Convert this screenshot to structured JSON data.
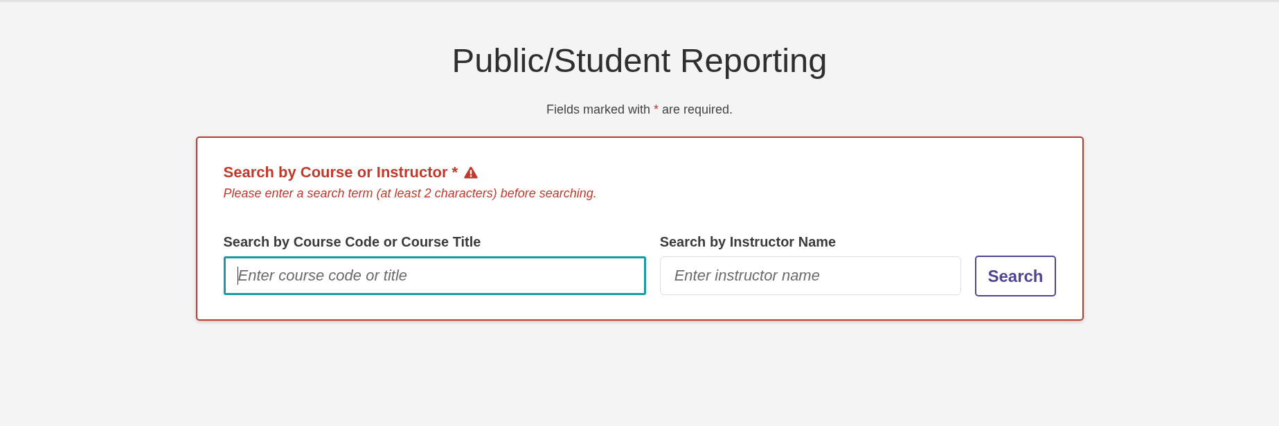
{
  "page": {
    "title": "Public/Student Reporting",
    "required_note": {
      "before": "Fields marked with",
      "marker": "*",
      "after": "are required."
    }
  },
  "search_panel": {
    "invalid": true,
    "heading": "Search by Course or Instructor *",
    "error_message": "Please enter a search term (at least 2 characters) before searching.",
    "fields": [
      {
        "label": "Search by Course Code or Course Title",
        "placeholder": "Enter course code or title",
        "focused": true
      },
      {
        "label": "Search by Instructor Name",
        "placeholder": "Enter instructor name",
        "focused": false
      }
    ],
    "button": "Search"
  }
}
